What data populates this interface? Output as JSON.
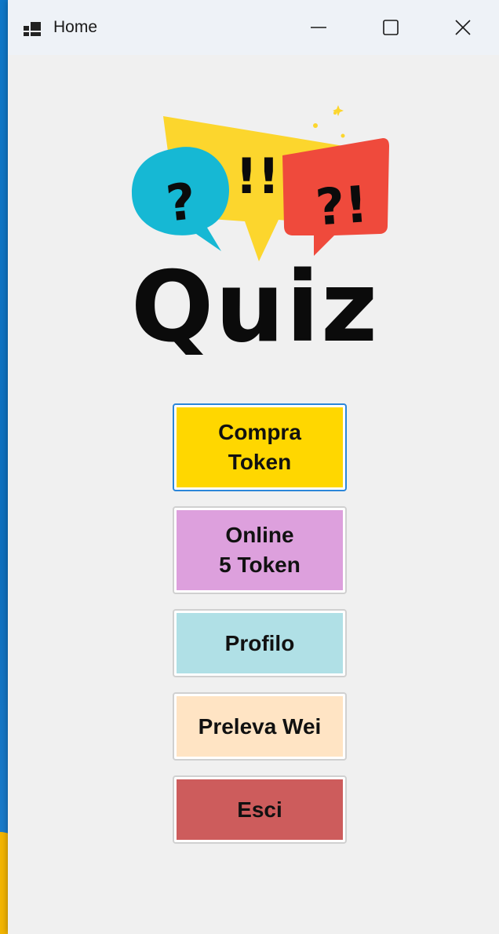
{
  "window": {
    "title": "Home",
    "minimize_symbol": "—",
    "maximize_symbol": "☐",
    "close_symbol": "✕"
  },
  "logo": {
    "word": "Quiz",
    "bubble_left_text": "?",
    "bubble_center_text": "!!",
    "bubble_right_text": "?!",
    "colors": {
      "yellow": "#fcd62d",
      "cyan": "#16b8d4",
      "red": "#ef4a3c",
      "black": "#0b0b0b"
    }
  },
  "buttons": [
    {
      "label": "Compra\nToken",
      "color": "#ffd700"
    },
    {
      "label": "Online\n5 Token",
      "color": "#dda0dd"
    },
    {
      "label": "Profilo",
      "color": "#b0e0e6"
    },
    {
      "label": "Preleva Wei",
      "color": "#ffe4c4"
    },
    {
      "label": "Esci",
      "color": "#cd5c5c"
    }
  ]
}
